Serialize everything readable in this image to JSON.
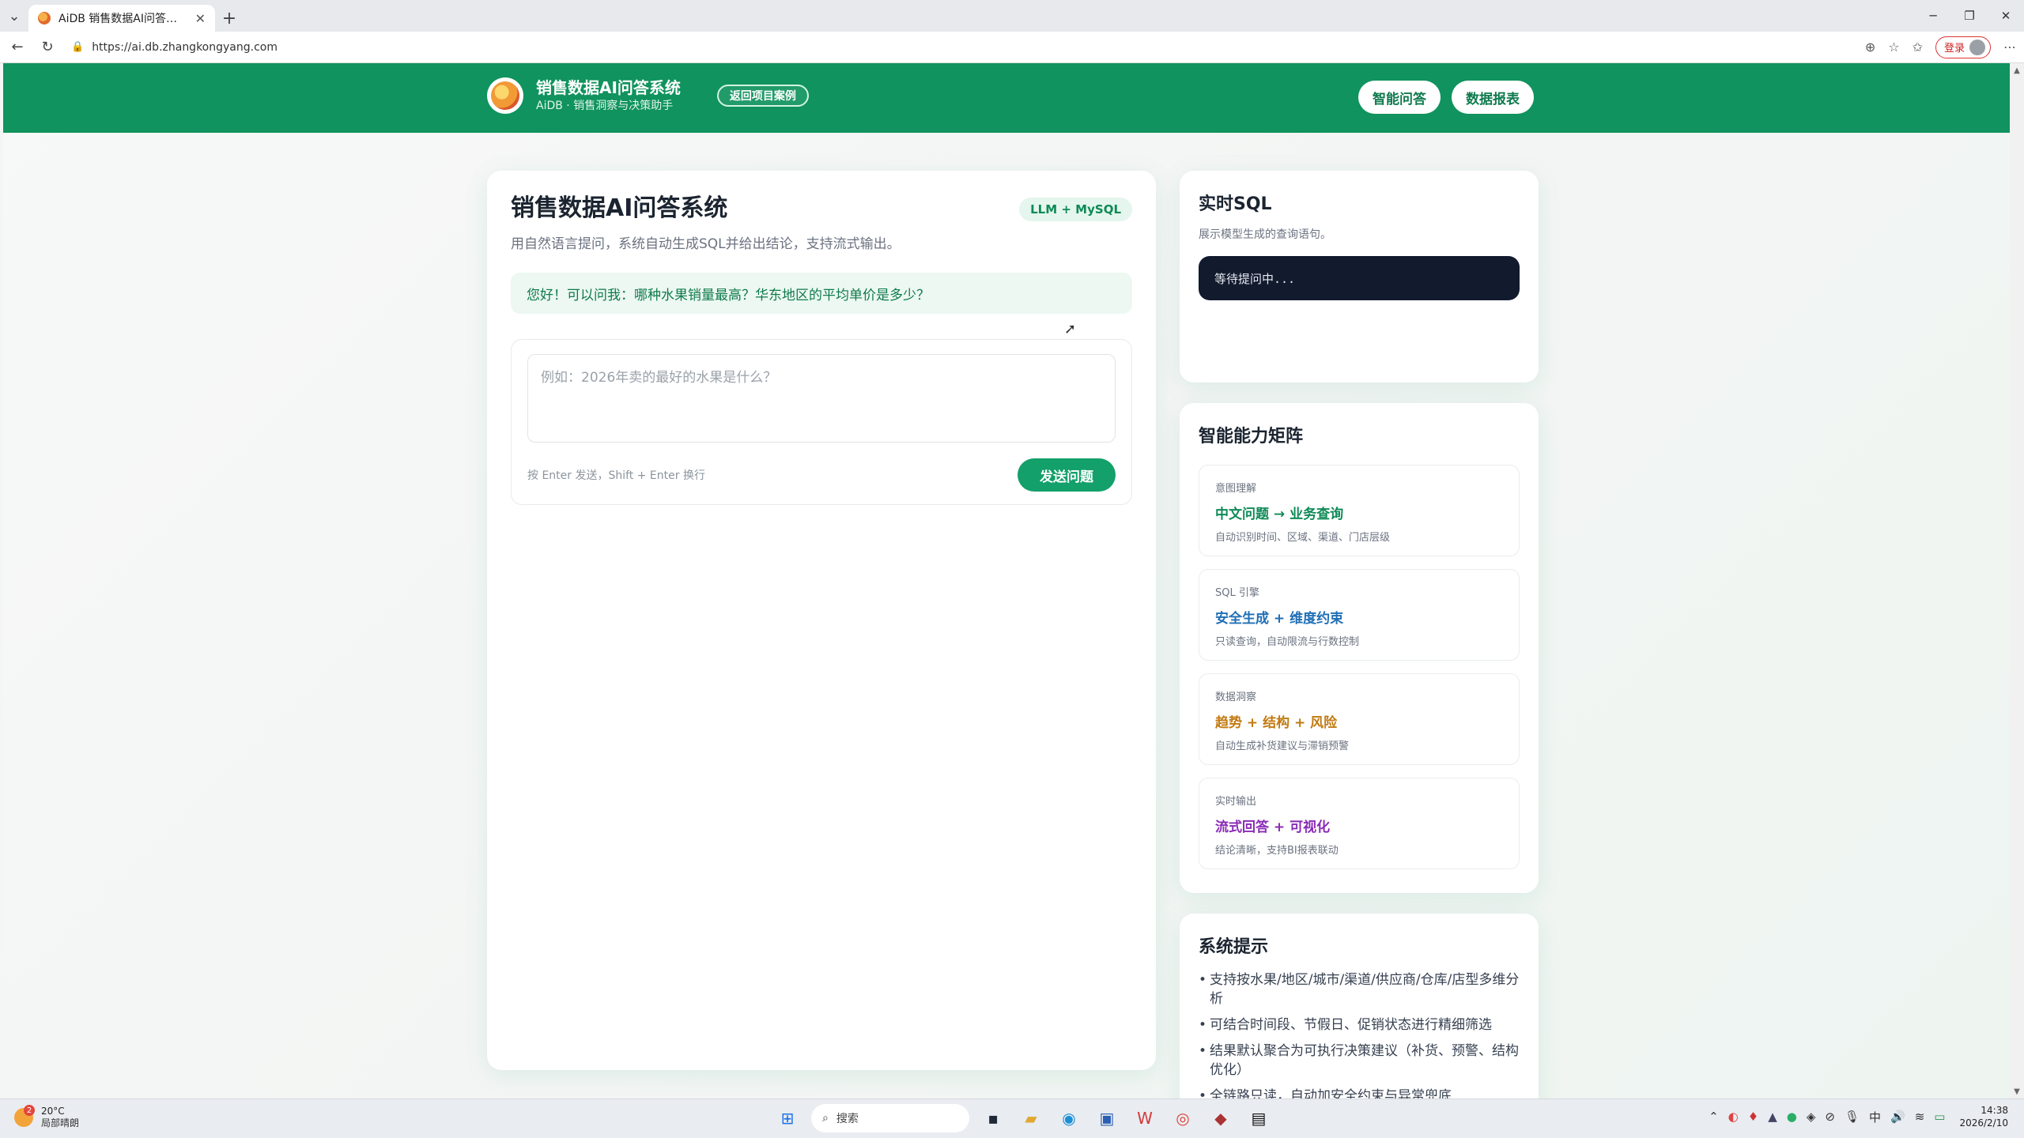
{
  "browser": {
    "tab_title": "AiDB 销售数据AI问答系统",
    "url": "https://ai.db.zhangkongyang.com",
    "login_label": "登录"
  },
  "header": {
    "brand_title": "销售数据AI问答系统",
    "brand_subtitle": "AiDB · 销售洞察与决策助手",
    "back_label": "返回项目案例",
    "nav": [
      "智能问答",
      "数据报表"
    ]
  },
  "main": {
    "title": "销售数据AI问答系统",
    "badge": "LLM + MySQL",
    "subtitle": "用自然语言提问，系统自动生成SQL并给出结论，支持流式输出。",
    "hint": "您好！可以问我：哪种水果销量最高？华东地区的平均单价是多少？",
    "input_placeholder": "例如：2026年卖的最好的水果是什么？",
    "input_tip": "按 Enter 发送，Shift + Enter 换行",
    "send_label": "发送问题"
  },
  "sql": {
    "title": "实时SQL",
    "subtitle": "展示模型生成的查询语句。",
    "status": "等待提问中..."
  },
  "capabilities": {
    "title": "智能能力矩阵",
    "items": [
      {
        "tag": "意图理解",
        "main": "中文问题 → 业务查询",
        "desc": "自动识别时间、区域、渠道、门店层级",
        "color": "#0f8a57"
      },
      {
        "tag": "SQL 引擎",
        "main": "安全生成 + 维度约束",
        "desc": "只读查询，自动限流与行数控制",
        "color": "#1f6fb5"
      },
      {
        "tag": "数据洞察",
        "main": "趋势 + 结构 + 风险",
        "desc": "自动生成补货建议与滞销预警",
        "color": "#c27a12"
      },
      {
        "tag": "实时输出",
        "main": "流式回答 + 可视化",
        "desc": "结论清晰，支持BI报表联动",
        "color": "#8a2bb5"
      }
    ]
  },
  "tips": {
    "title": "系统提示",
    "items": [
      "支持按水果/地区/城市/渠道/供应商/仓库/店型多维分析",
      "可结合时间段、节假日、促销状态进行精细筛选",
      "结果默认聚合为可执行决策建议（补货、预警、结构优化）",
      "全链路只读，自动加安全约束与异常兜底"
    ]
  },
  "taskbar": {
    "temp": "20°C",
    "weather": "局部晴朗",
    "weather_badge": "2",
    "search_label": "搜索",
    "time": "14:38",
    "date": "2026/2/10",
    "ime": "中"
  }
}
